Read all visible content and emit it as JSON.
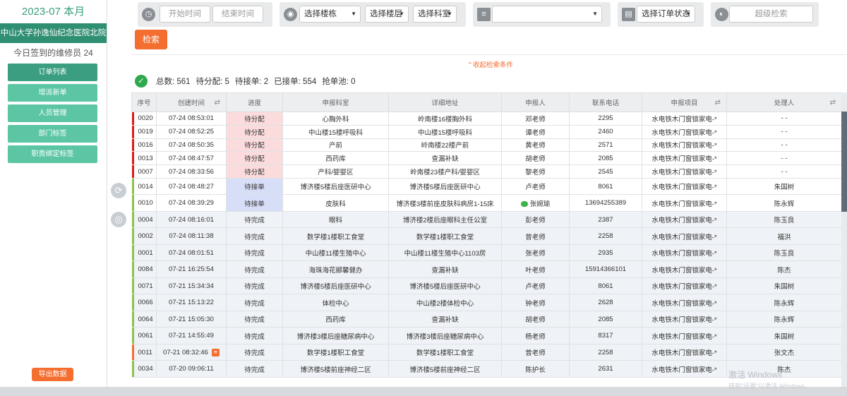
{
  "sidebar": {
    "month": "2023-07 本月",
    "hospital": "中山大学孙逸仙纪念医院北院",
    "signin": "今日签到的维修员 24",
    "nav": [
      "订单列表",
      "增派新单",
      "人员管理",
      "部门标签",
      "职责绑定标签"
    ],
    "export": "导出数据"
  },
  "filters": {
    "start_placeholder": "开始时间",
    "end_placeholder": "结束时间",
    "building": "选择楼栋",
    "floor": "选择楼层",
    "dept": "选择科室",
    "blank_select": "",
    "order_status": "选择订单状态",
    "advanced": "超级检索",
    "search": "检索",
    "collapse": "⌃收起检索条件"
  },
  "stats": {
    "total": "总数: 561",
    "pending": "待分配: 5",
    "waiting": "待接单: 2",
    "accepted": "已接单: 554",
    "pool": "抢单池: 0"
  },
  "colors": {
    "accent_green": "#3a9d7e",
    "nav_green": "#5cc6a4",
    "orange": "#f46e30",
    "pending_bg": "#fbdbdc",
    "waiting_bg": "#d7def7",
    "bar_red": "#e01a1a",
    "bar_green": "#8bc34a",
    "bar_orange": "#f46e30"
  },
  "table": {
    "headers": [
      "序号",
      "创建时间",
      "进度",
      "申报科室",
      "详细地址",
      "申报人",
      "联系电话",
      "申报项目",
      "处理人"
    ],
    "rows": [
      {
        "id": "0020",
        "time": "07-24 08:53:01",
        "status": "待分配",
        "dept": "心胸外科",
        "addr": "岭南楼16楼胸外科",
        "person": "邓老师",
        "phone": "2295",
        "item": "水电铁木门窗锁家电-*",
        "handler": "- -",
        "bar": "red",
        "kind": "pend"
      },
      {
        "id": "0019",
        "time": "07-24 08:52:25",
        "status": "待分配",
        "dept": "中山楼15楼呼吸科",
        "addr": "中山楼15楼呼吸科",
        "person": "谭老师",
        "phone": "2460",
        "item": "水电铁木门窗锁家电-*",
        "handler": "- -",
        "bar": "red",
        "kind": "pend"
      },
      {
        "id": "0016",
        "time": "07-24 08:50:35",
        "status": "待分配",
        "dept": "产前",
        "addr": "岭南楼22楼产前",
        "person": "黄老师",
        "phone": "2571",
        "item": "水电铁木门窗锁家电-*",
        "handler": "- -",
        "bar": "red",
        "kind": "pend"
      },
      {
        "id": "0013",
        "time": "07-24 08:47:57",
        "status": "待分配",
        "dept": "西药库",
        "addr": "查漏补缺",
        "person": "胡老师",
        "phone": "2085",
        "item": "水电铁木门窗锁家电-*",
        "handler": "- -",
        "bar": "red",
        "kind": "pend"
      },
      {
        "id": "0007",
        "time": "07-24 08:33:56",
        "status": "待分配",
        "dept": "产科/婴婴区",
        "addr": "岭南楼23楼产科/婴婴区",
        "person": "黎老师",
        "phone": "2545",
        "item": "水电铁木门窗锁家电-*",
        "handler": "- -",
        "bar": "red",
        "kind": "pend"
      },
      {
        "id": "0014",
        "time": "07-24 08:48:27",
        "status": "待接单",
        "dept": "博济楼5楼后座医研中心",
        "addr": "博济楼5楼后座医研中心",
        "person": "卢老师",
        "phone": "8061",
        "item": "水电铁木门窗锁家电-*",
        "handler": "朱国树",
        "bar": "green",
        "kind": "wait"
      },
      {
        "id": "0010",
        "time": "07-24 08:39:29",
        "status": "待接单",
        "dept": "皮肤科",
        "addr": "博济楼3楼前座皮肤科病房1-15床",
        "person": "张婉瑜",
        "phone": "13694255389",
        "item": "水电铁木门窗锁家电-*",
        "handler": "陈永辉",
        "bar": "green",
        "kind": "wait",
        "wechat": true
      },
      {
        "id": "0004",
        "time": "07-24 08:16:01",
        "status": "待完成",
        "dept": "眼科",
        "addr": "博济楼2楼后座眼科主任公室",
        "person": "彭老师",
        "phone": "2387",
        "item": "水电铁木门窗锁家电-*",
        "handler": "陈玉良",
        "bar": "green",
        "kind": "done"
      },
      {
        "id": "0002",
        "time": "07-24 08:11:38",
        "status": "待完成",
        "dept": "数学楼1楼职工食堂",
        "addr": "数学楼1楼职工食堂",
        "person": "曾老师",
        "phone": "2258",
        "item": "水电铁木门窗锁家电-*",
        "handler": "福洪",
        "bar": "green",
        "kind": "done"
      },
      {
        "id": "0001",
        "time": "07-24 08:01:51",
        "status": "待完成",
        "dept": "中山楼11楼生殖中心",
        "addr": "中山楼11楼生殖中心1103房",
        "person": "张老师",
        "phone": "2935",
        "item": "水电铁木门窗锁家电-*",
        "handler": "陈玉良",
        "bar": "green",
        "kind": "done"
      },
      {
        "id": "0084",
        "time": "07-21 16:25:54",
        "status": "待完成",
        "dept": "海珠海花郦馨健办",
        "addr": "查漏补缺",
        "person": "叶老师",
        "phone": "15914366101",
        "item": "水电铁木门窗锁家电-*",
        "handler": "陈杰",
        "bar": "green",
        "kind": "done"
      },
      {
        "id": "0071",
        "time": "07-21 15:34:34",
        "status": "待完成",
        "dept": "博济楼5楼后座医研中心",
        "addr": "博济楼5楼后座医研中心",
        "person": "卢老师",
        "phone": "8061",
        "item": "水电铁木门窗锁家电-*",
        "handler": "朱国树",
        "bar": "green",
        "kind": "done"
      },
      {
        "id": "0066",
        "time": "07-21 15:13:22",
        "status": "待完成",
        "dept": "体检中心",
        "addr": "中山楼2楼体检中心",
        "person": "钟老师",
        "phone": "2628",
        "item": "水电铁木门窗锁家电-*",
        "handler": "陈永辉",
        "bar": "green",
        "kind": "done"
      },
      {
        "id": "0064",
        "time": "07-21 15:05:30",
        "status": "待完成",
        "dept": "西药库",
        "addr": "查漏补缺",
        "person": "胡老师",
        "phone": "2085",
        "item": "水电铁木门窗锁家电-*",
        "handler": "陈永辉",
        "bar": "green",
        "kind": "done"
      },
      {
        "id": "0061",
        "time": "07-21 14:55:49",
        "status": "待完成",
        "dept": "博济楼3楼后座糖尿病中心",
        "addr": "博济楼3楼后座糖尿病中心",
        "person": "杨老师",
        "phone": "8317",
        "item": "水电铁木门窗锁家电-*",
        "handler": "朱国树",
        "bar": "green",
        "kind": "done"
      },
      {
        "id": "0011",
        "time": "07-21 08:32:46",
        "status": "待完成",
        "dept": "数学楼1楼职工食堂",
        "addr": "数学楼1楼职工食堂",
        "person": "曾老师",
        "phone": "2258",
        "item": "水电铁木门窗锁家电-*",
        "handler": "张文杰",
        "bar": "orange",
        "kind": "done",
        "note": true
      },
      {
        "id": "0034",
        "time": "07-20 09:06:11",
        "status": "待完成",
        "dept": "博济楼5楼前座神经二区",
        "addr": "博济楼5楼前座神经二区",
        "person": "陈护长",
        "phone": "2631",
        "item": "水电铁木门窗锁家电-*",
        "handler": "陈杰",
        "bar": "green",
        "kind": "done"
      }
    ]
  },
  "watermark": {
    "line1": "激活 Windows",
    "line2": "转到\"设置\"以激活 Windows。"
  }
}
